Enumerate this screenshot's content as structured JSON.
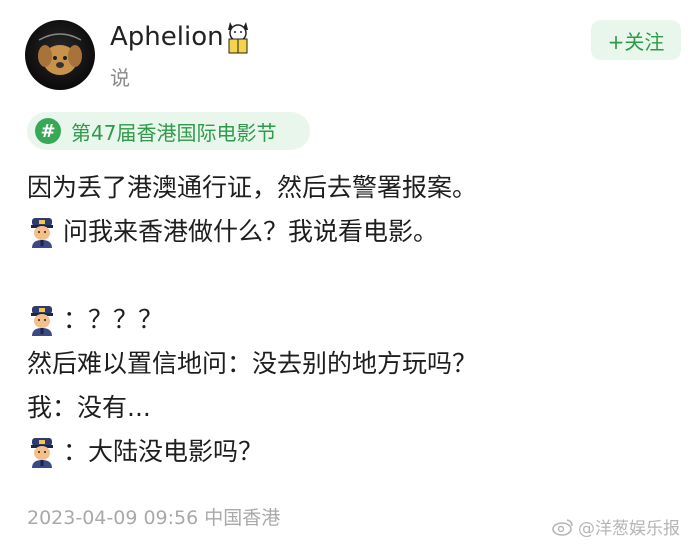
{
  "post": {
    "username": "Aphelion",
    "action": "说",
    "follow_label": "+关注",
    "topic": "第47届香港国际电影节",
    "lines": [
      "因为丢了港澳通行证，然后去警署报案。",
      "问我来香港做什么？我说看电影。",
      "",
      "：？？？",
      "然后难以置信地问：没去别的地方玩吗？",
      "我：没有...",
      "：大陆没电影吗？"
    ],
    "timestamp": "2023-04-09 09:56 中国香港"
  },
  "watermark": {
    "text": "@洋葱娱乐报"
  },
  "colors": {
    "accent_green": "#37a956",
    "follow_bg": "#e9f6ec"
  },
  "icons": {
    "avatar": "dog-avatar",
    "badge": "cat-reading-badge",
    "topic": "hashtag-icon",
    "speaker": "police-officer-emoji",
    "watermark": "weibo-icon"
  }
}
